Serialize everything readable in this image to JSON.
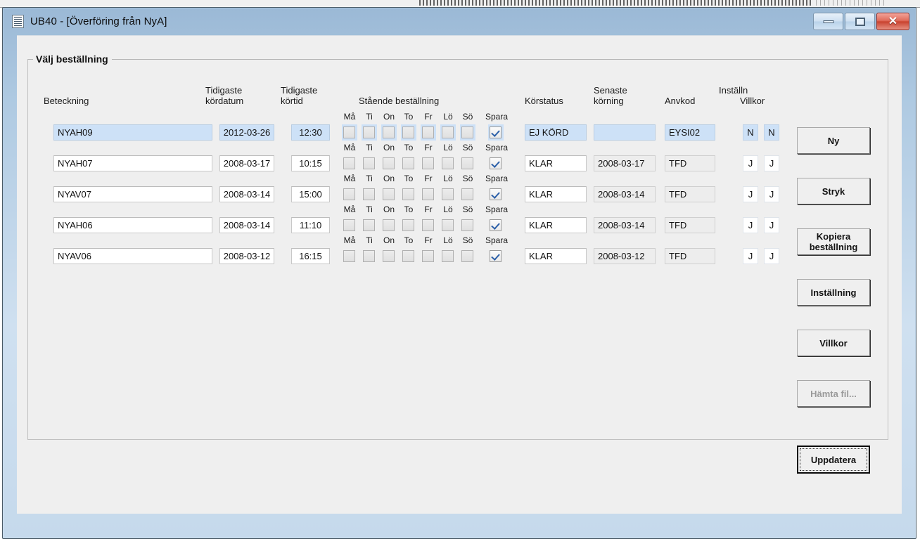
{
  "window": {
    "title": "UB40 - [Överföring från NyA]",
    "icon": "document-window-icon",
    "controls": {
      "minimize": "minimize-icon",
      "maximize": "maximize-icon",
      "close": "close-icon"
    }
  },
  "group": {
    "legend": "Välj beställning"
  },
  "headers": {
    "beteckning": "Beteckning",
    "tidigaste_kordatum_l1": "Tidigaste",
    "tidigaste_kordatum_l2": "kördatum",
    "tidigaste_kortid_l1": "Tidigaste",
    "tidigaste_kortid_l2": "körtid",
    "staende_bestallning": "Stående beställning",
    "korstatus": "Körstatus",
    "senaste_korning_l1": "Senaste",
    "senaste_korning_l2": "körning",
    "anvkod": "Anvkod",
    "installn": "Inställn",
    "villkor": "Villkor"
  },
  "day_labels": [
    "Må",
    "Ti",
    "On",
    "To",
    "Fr",
    "Lö",
    "Sö"
  ],
  "spara_label": "Spara",
  "rows": [
    {
      "beteckning": "NYAH09",
      "kordatum": "2012-03-26",
      "kortid": "12:30",
      "days": [
        false,
        false,
        false,
        false,
        false,
        false,
        false
      ],
      "spara": true,
      "korstatus": "EJ KÖRD",
      "senaste_korning": "",
      "anvkod": "EYSI02",
      "installn": "N",
      "villkor": "N",
      "selected": true
    },
    {
      "beteckning": "NYAH07",
      "kordatum": "2008-03-17",
      "kortid": "10:15",
      "days": [
        false,
        false,
        false,
        false,
        false,
        false,
        false
      ],
      "spara": true,
      "korstatus": "KLAR",
      "senaste_korning": "2008-03-17",
      "anvkod": "TFD",
      "installn": "J",
      "villkor": "J",
      "selected": false
    },
    {
      "beteckning": "NYAV07",
      "kordatum": "2008-03-14",
      "kortid": "15:00",
      "days": [
        false,
        false,
        false,
        false,
        false,
        false,
        false
      ],
      "spara": true,
      "korstatus": "KLAR",
      "senaste_korning": "2008-03-14",
      "anvkod": "TFD",
      "installn": "J",
      "villkor": "J",
      "selected": false
    },
    {
      "beteckning": "NYAH06",
      "kordatum": "2008-03-14",
      "kortid": "11:10",
      "days": [
        false,
        false,
        false,
        false,
        false,
        false,
        false
      ],
      "spara": true,
      "korstatus": "KLAR",
      "senaste_korning": "2008-03-14",
      "anvkod": "TFD",
      "installn": "J",
      "villkor": "J",
      "selected": false
    },
    {
      "beteckning": "NYAV06",
      "kordatum": "2008-03-12",
      "kortid": "16:15",
      "days": [
        false,
        false,
        false,
        false,
        false,
        false,
        false
      ],
      "spara": true,
      "korstatus": "KLAR",
      "senaste_korning": "2008-03-12",
      "anvkod": "TFD",
      "installn": "J",
      "villkor": "J",
      "selected": false
    }
  ],
  "buttons": {
    "ny": "Ny",
    "stryk": "Stryk",
    "kopiera": "Kopiera\nbeställning",
    "installning": "Inställning",
    "villkor": "Villkor",
    "hamta_fil": "Hämta fil...",
    "uppdatera": "Uppdatera"
  },
  "colors": {
    "selection": "#cde1f7",
    "client_bg": "#efefef",
    "titlebar": "#b9d0e6",
    "close_button": "#c9422f",
    "check_mark": "#2b5fa8"
  }
}
